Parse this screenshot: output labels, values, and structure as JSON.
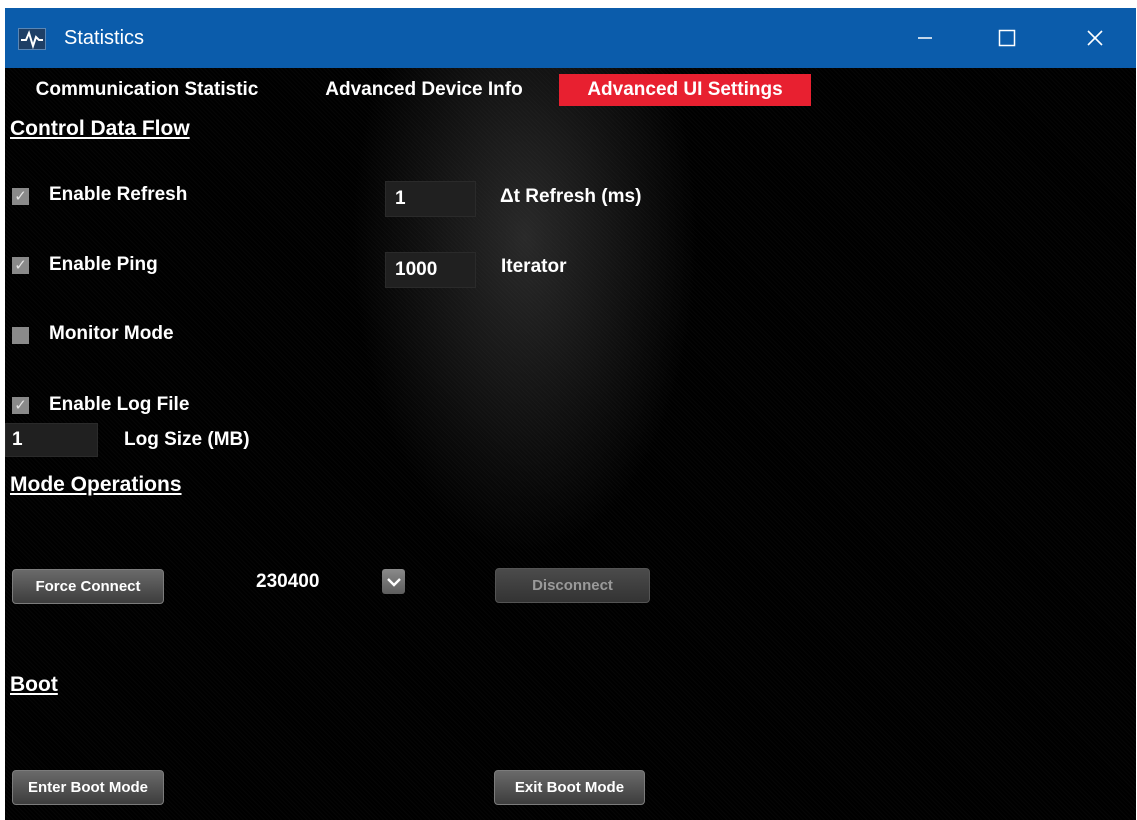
{
  "window": {
    "title": "Statistics",
    "app_icon": "waveform-icon",
    "controls": [
      "minimize-icon",
      "maximize-icon",
      "close-icon"
    ]
  },
  "tabs": [
    {
      "label": "Communication Statistic",
      "selected": false
    },
    {
      "label": "Advanced Device Info",
      "selected": false
    },
    {
      "label": "Advanced UI Settings",
      "selected": true
    }
  ],
  "control_data_flow": {
    "heading": "Control Data Flow",
    "enable_refresh": {
      "label": "Enable Refresh",
      "checked": true
    },
    "refresh_interval": {
      "value": "1",
      "label": "Δt Refresh (ms)"
    },
    "enable_ping": {
      "label": "Enable Ping",
      "checked": true
    },
    "iterator": {
      "value": "1000",
      "label": "Iterator"
    },
    "monitor_mode": {
      "label": "Monitor Mode",
      "checked": false
    },
    "enable_log_file": {
      "label": "Enable Log File",
      "checked": true
    },
    "log_size": {
      "value": "1",
      "label": "Log Size (MB)"
    }
  },
  "mode_operations": {
    "heading": "Mode Operations",
    "force_connect_label": "Force Connect",
    "baud_rate": "230400",
    "disconnect_label": "Disconnect"
  },
  "boot": {
    "heading": "Boot",
    "enter_label": "Enter Boot Mode",
    "exit_label": "Exit Boot Mode"
  },
  "colors": {
    "titlebar": "#0b5cab",
    "active_tab": "#e82030",
    "background": "#000000"
  }
}
